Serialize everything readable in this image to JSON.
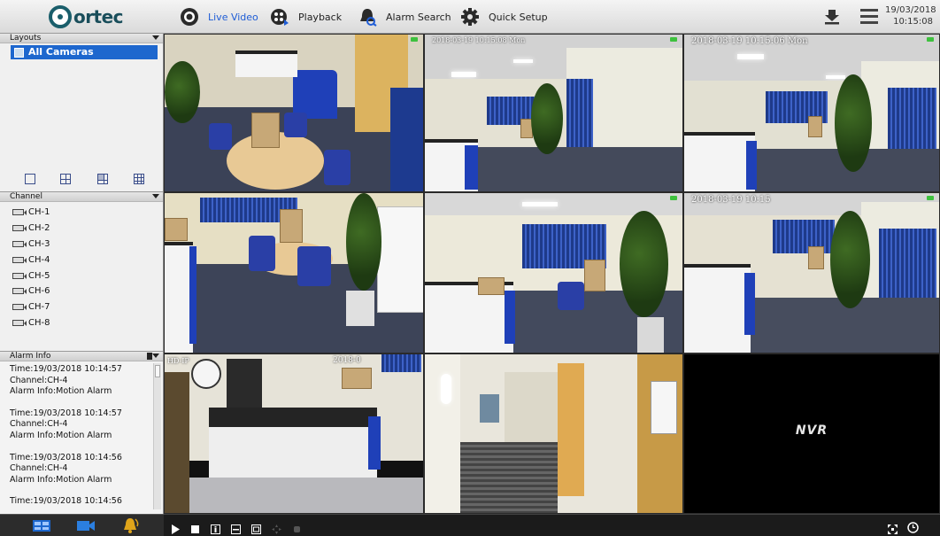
{
  "brand": {
    "name": "ortec",
    "logo_letter": "V"
  },
  "nav": {
    "live_video": "Live Video",
    "playback": "Playback",
    "alarm_search": "Alarm Search",
    "quick_setup": "Quick Setup"
  },
  "datetime": {
    "date": "19/03/2018",
    "time": "10:15:08"
  },
  "layouts": {
    "title": "Layouts",
    "selected": "All Cameras"
  },
  "channel": {
    "title": "Channel",
    "items": [
      "CH-1",
      "CH-2",
      "CH-3",
      "CH-4",
      "CH-5",
      "CH-6",
      "CH-7",
      "CH-8"
    ]
  },
  "alarm_info": {
    "title": "Alarm Info",
    "entries": [
      {
        "time": "Time:19/03/2018 10:14:57",
        "channel": "Channel:CH-4",
        "info": "Alarm Info:Motion Alarm"
      },
      {
        "time": "Time:19/03/2018 10:14:57",
        "channel": "Channel:CH-4",
        "info": "Alarm Info:Motion Alarm"
      },
      {
        "time": "Time:19/03/2018 10:14:56",
        "channel": "Channel:CH-4",
        "info": "Alarm Info:Motion Alarm"
      },
      {
        "time": "Time:19/03/2018 10:14:56",
        "channel": "",
        "info": ""
      }
    ]
  },
  "tiles": {
    "t2_timestamp": "2018-03-19 10:15:08 Mon",
    "t3_timestamp": "2018-03-19 10:15:06 Mon",
    "t6_timestamp": "2018-03-19 10:15",
    "t7_label": "HD-IP",
    "t7_timestamp": "2018-0",
    "empty_label": "NVR"
  },
  "colors": {
    "accent_blue": "#1d67ce",
    "active_nav": "#1f5dd6",
    "rec_indicator": "#3ec13e"
  }
}
